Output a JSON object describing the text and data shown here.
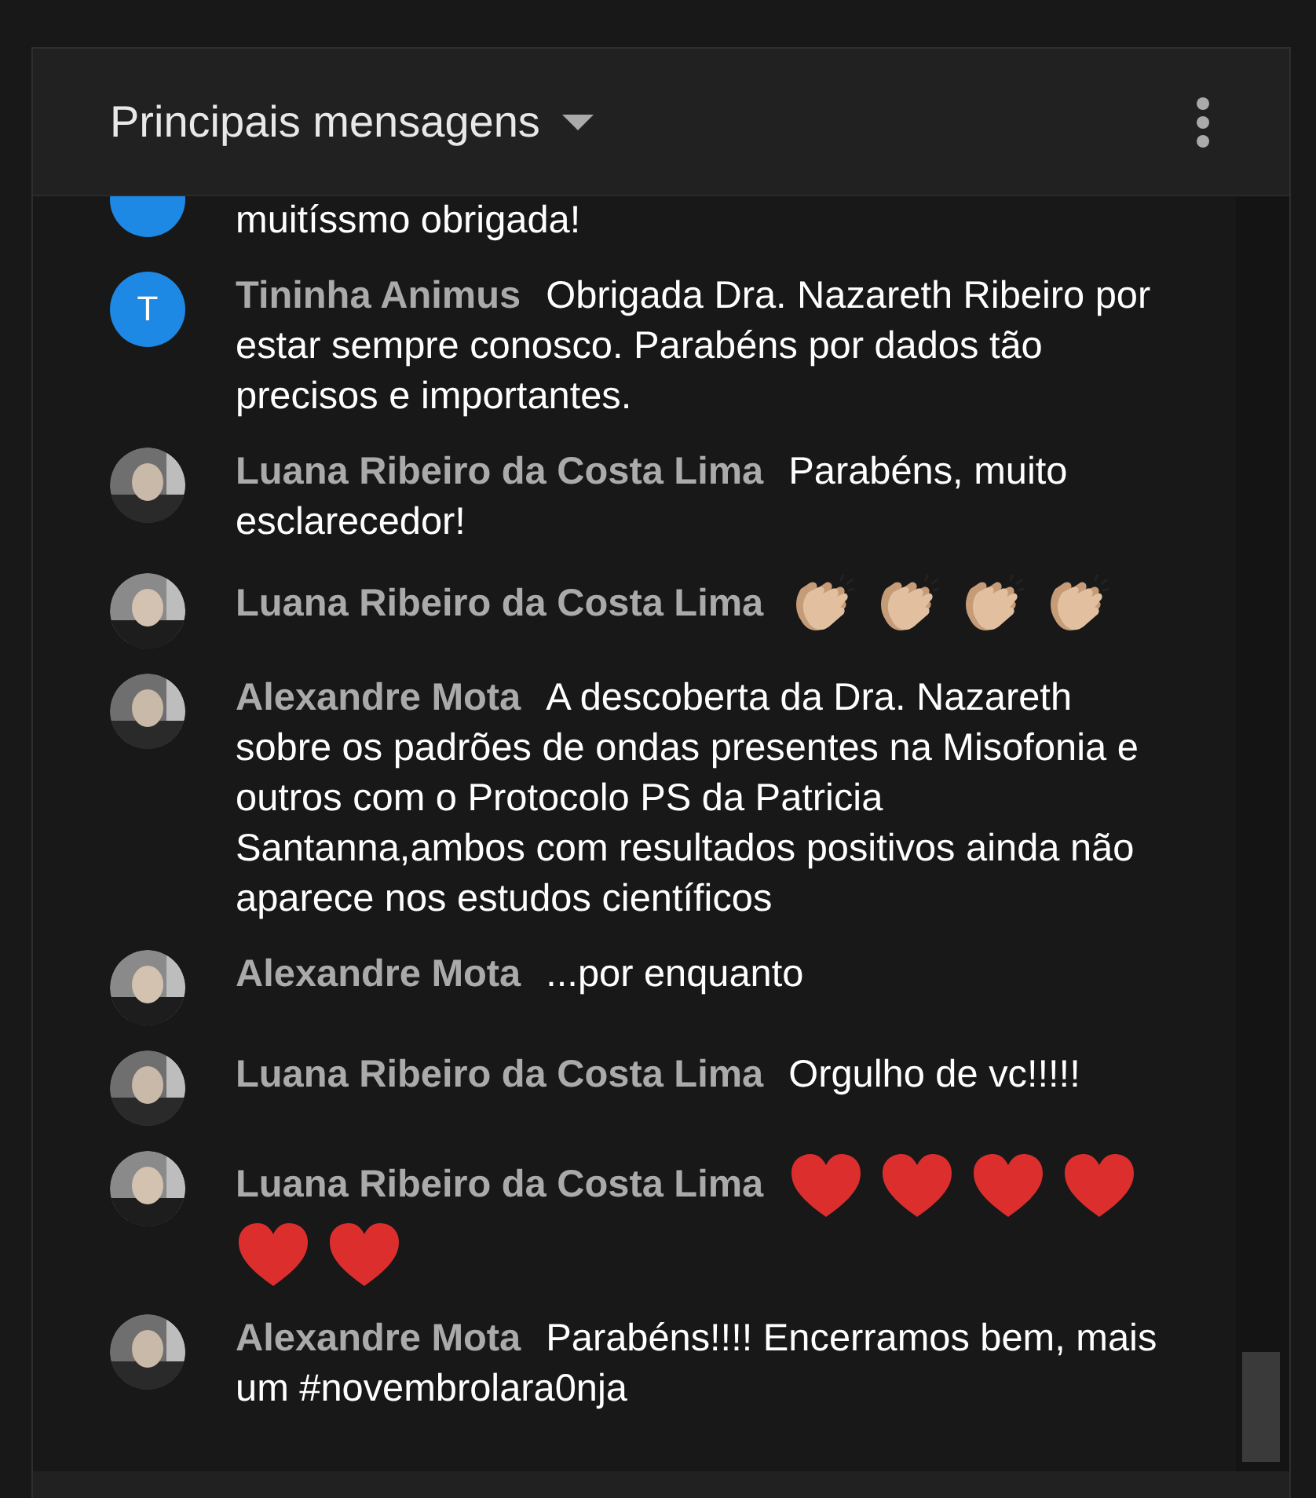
{
  "header": {
    "title": "Principais mensagens"
  },
  "messages": [
    {
      "kind": "cut",
      "avatar": {
        "kind": "letter",
        "color": "#1e88e5"
      },
      "text": "muitíssmo obrigada!"
    },
    {
      "kind": "text",
      "author": "Tininha Animus",
      "avatar": {
        "kind": "letter",
        "letter": "T",
        "color": "#1e88e5"
      },
      "text": "Obrigada Dra. Nazareth Ribeiro por estar sempre conosco. Parabéns por dados tão precisos e importantes."
    },
    {
      "kind": "text",
      "author": "Luana Ribeiro da Costa Lima",
      "text": "Parabéns, muito esclarecedor!"
    },
    {
      "kind": "emoji",
      "author": "Luana Ribeiro da Costa Lima",
      "emojis": [
        {
          "kind": "clap"
        },
        {
          "kind": "clap"
        },
        {
          "kind": "clap"
        },
        {
          "kind": "clap"
        }
      ]
    },
    {
      "kind": "text",
      "author": "Alexandre Mota",
      "text": "A descoberta da Dra. Nazareth sobre os padrões de ondas presentes na Misofonia e outros com o Protocolo PS da Patricia Santanna,ambos com resultados positivos ainda não aparece nos estudos científicos"
    },
    {
      "kind": "text",
      "author": "Alexandre Mota",
      "text": "...por enquanto"
    },
    {
      "kind": "text",
      "author": "Luana Ribeiro da Costa Lima",
      "text": "Orgulho de vc!!!!!"
    },
    {
      "kind": "emoji",
      "author": "Luana Ribeiro da Costa Lima",
      "emojis": [
        {
          "kind": "heart"
        },
        {
          "kind": "heart"
        },
        {
          "kind": "heart"
        },
        {
          "kind": "heart"
        },
        {
          "kind": "heart"
        },
        {
          "kind": "heart"
        }
      ]
    },
    {
      "kind": "text",
      "author": "Alexandre Mota",
      "text": "Parabéns!!!! Encerramos bem, mais um #novembrolara0nja"
    }
  ]
}
